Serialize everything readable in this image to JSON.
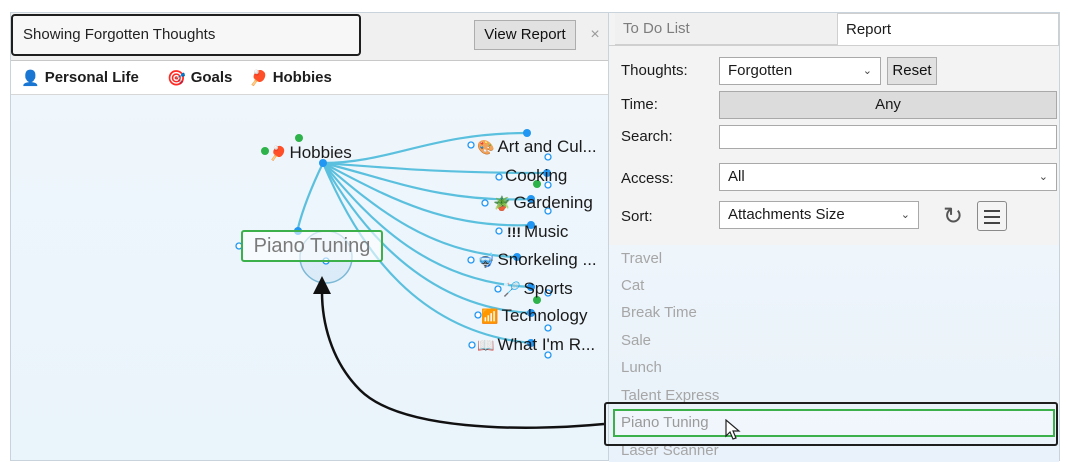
{
  "header": {
    "status_text": "Showing Forgotten Thoughts",
    "view_report_label": "View Report",
    "close_glyph": "×"
  },
  "breadcrumbs": [
    {
      "icon": "person-icon",
      "glyph": "👤",
      "label": "Personal Life"
    },
    {
      "icon": "target-icon",
      "glyph": "🎯",
      "label": "Goals"
    },
    {
      "icon": "ping-pong-icon",
      "glyph": "🏓",
      "label": "Hobbies"
    }
  ],
  "map": {
    "central": {
      "label": "Hobbies",
      "icon": "ping-pong-icon",
      "glyph": "🏓"
    },
    "children": [
      {
        "label": "Art and Cul...",
        "icon": "art-icon",
        "glyph": "🎨"
      },
      {
        "label": "Cooking",
        "icon": "",
        "glyph": ""
      },
      {
        "label": "Gardening",
        "icon": "plant-icon",
        "glyph": "🪴"
      },
      {
        "label": "Music",
        "icon": "exclamation-icon",
        "glyph": "!!!"
      },
      {
        "label": "Snorkeling ...",
        "icon": "snorkel-icon",
        "glyph": "🤿"
      },
      {
        "label": "Sports",
        "icon": "badminton-icon",
        "glyph": "🏸"
      },
      {
        "label": "Technology",
        "icon": "wifi-icon",
        "glyph": "📶"
      },
      {
        "label": "What I'm R...",
        "icon": "book-icon",
        "glyph": "📖"
      }
    ],
    "forgotten_thought": "Piano Tuning"
  },
  "report_panel": {
    "tabs": [
      {
        "label": "To Do List",
        "active": false
      },
      {
        "label": "Report",
        "active": true
      }
    ],
    "thoughts_label": "Thoughts:",
    "thoughts_value": "Forgotten",
    "reset_label": "Reset",
    "time_label": "Time:",
    "time_value": "Any",
    "search_label": "Search:",
    "search_value": "",
    "access_label": "Access:",
    "access_value": "All",
    "sort_label": "Sort:",
    "sort_value": "Attachments Size",
    "results": [
      "Travel",
      "Cat",
      "Break Time",
      "Sale",
      "Lunch",
      "Talent Express",
      "Piano Tuning",
      "Laser Scanner"
    ]
  },
  "colors": {
    "link_line": "#5bc0de",
    "node_dot": "#2196f3",
    "green_dot": "#2db34a",
    "highlight_green": "#3bb04b",
    "outline_dark": "#1e1e1e"
  }
}
